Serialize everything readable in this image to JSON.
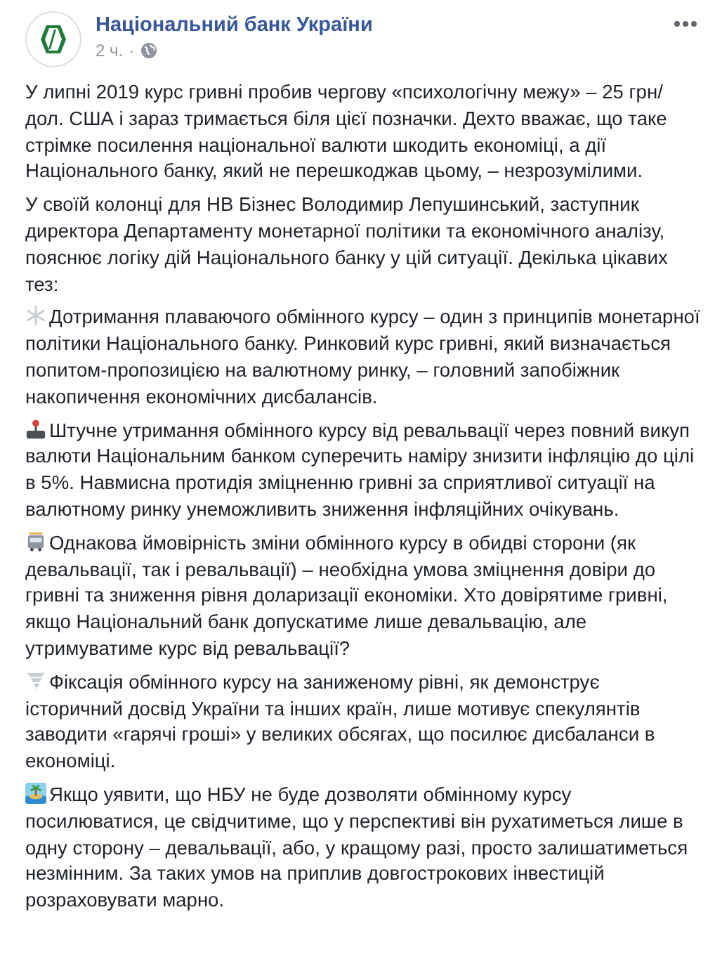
{
  "post": {
    "author": "Національний банк України",
    "time": "2 ч.",
    "separator": "·"
  },
  "paragraphs": [
    {
      "text": "У липні 2019 курс гривні пробив чергову «психологічну межу» – 25 грн/дол. США і зараз тримається біля цієї позначки. Дехто вважає, що таке стрімке посилення національної валюти шкодить економіці, а дії Національного банку, який не перешкоджав цьому, – незрозумілими."
    },
    {
      "text": "У своїй колонці для НВ Бізнес Володимир Лепушинський, заступник директора Департаменту монетарної політики та економічного аналізу, пояснює логіку дій Національного банку у цій ситуації. Декілька цікавих тез:"
    },
    {
      "text": "Дотримання плаваючого обмінного курсу – один з принципів монетарної політики Національного банку. Ринковий курс гривні, який визначається попитом-пропозицією на валютному ринку, – головний запобіжник накопичення економічних дисбалансів."
    },
    {
      "text": "Штучне утримання обмінного курсу від ревальвації через повний викуп валюти Національним банком суперечить наміру знизити інфляцію до цілі в 5%. Навмисна протидія зміцненню гривні за сприятливої ситуації на валютному ринку унеможливить зниження інфляційних очікувань."
    },
    {
      "text": "Однакова ймовірність зміни обмінного курсу в обидві сторони (як девальвації, так і ревальвації) – необхідна умова зміцнення довіри до гривні та зниження рівня доларизації економіки. Хто довірятиме гривні, якщо Національний банк допускатиме лише девальвацію, але утримуватиме курс від ревальвації?"
    },
    {
      "text": "Фіксація обмінного курсу на заниженому рівні, як демонструє історичний досвід України та інших країн, лише мотивує спекулянтів заводити «гарячі гроші» у великих обсягах, що посилює дисбаланси в економіці."
    },
    {
      "text": "Якщо уявити, що НБУ не буде дозволяти обмінному курсу посилюватися, це свідчитиме, що у перспективі він рухатиметься лише в одну сторону – девальвації, або, у кращому разі, просто залишатиметься незмінним. За таких умов на приплив довгострокових інвестицій розраховувати марно."
    }
  ]
}
